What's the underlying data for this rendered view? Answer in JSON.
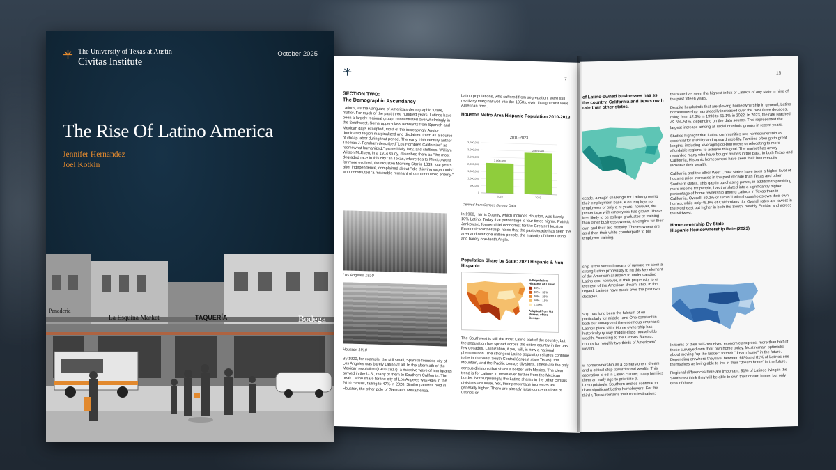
{
  "cover": {
    "university": "The University of Texas at Austin",
    "institute": "Civitas Institute",
    "date": "October 2025",
    "title": "The Rise Of Latino America",
    "authors": [
      "Jennifer Hernandez",
      "Joel Kotkin"
    ],
    "signs": [
      "La Esquina Market",
      "TAQUERÍA",
      "Bodega",
      "Panadería"
    ]
  },
  "page_left": {
    "page_number": "7",
    "section_title": "SECTION TWO:",
    "section_subtitle": "The Demographic Ascendancy",
    "col1_intro": "Latinos, as the vanguard of America's demographic future, matter. For much of the past three hundred years, Latinos have been a largely regional group, concentrated overwhelmingly in the Southwest. Some upper-class remnants from Spanish and Mexican days excepted, most of the increasingly Anglo-dominated region marginalized and disdained them as a source of cheap labor during that period. The early 19th century author Thomas J. Farnham described \"Los Hombres Californios\" as \"somewhat humanized,\" proverbially lazy, and shiftless. William Wilson McEuen, in a 1914 study, described them as \"the most degraded race in this city.\" In Texas, where ties to Mexico were far more evolved, the Houston Morning Star in 1839, four years after independence, complained about \"idle thieving vagabonds\" who constituted \"a miserable remnant of our conquered enemy.\"",
    "caption_la": "Los Angeles 1910",
    "caption_houston": "Houston 1910",
    "col1_bottom": "By 1900, for example, the still small, Spanish-founded city of Los Angeles was barely Latino at all. In the aftermath of the Mexican revolution (1910-1917), a massive wave of immigrants arrived in the U.S., many of them to Southern California. The peak Latino share for the city of Los Angeles was 48% in the 2010 census, falling to 47% in 2020. Similar patterns hold in Houston, the other pole of Garreau's Mexamerica.",
    "col2_top": "Latino populations, who suffered from segregation, were still relatively marginal well into the 1950s, even though most were American born.",
    "chart_heading": "Houston Metro Area Hispanic Population 2010-2013",
    "chart_source": "Derived from Census Bureau Data",
    "col2_mid": "In 1960, Harris County, which includes Houston, was barely 10% Latino. Today that percentage is four times higher. Patrick Jankowski, former chief economist for the Greater Houston Economic Partnership, notes that the past decade has seen the area add over one million people, the majority of them Latino and barely one-tenth Anglo.",
    "map_heading": "Population Share by State: 2020 Hispanic & Non-Hispanic",
    "map_legend_title": "% Population Hispanic or Latino",
    "map_legend_items": [
      "40% +",
      "30% - 39%",
      "20% - 29%",
      "10% - 19%",
      "< 10%"
    ],
    "map_legend_colors": [
      "#a8320e",
      "#d45a17",
      "#eb8d33",
      "#f5bf6c",
      "#fbe8b6"
    ],
    "map_note": "Adapted from US Bureau of the Census",
    "col2_bottom": "The Southwest is still the most Latino part of the country, but the population has spread across the entire country in the past few decades. Latinization, if you will, is now a national phenomenon. The strongest Latino population shares continue to be in the West South Central (largest state Texas), the Mountain, and the Pacific census divisions. These are the only census divisions that share a border with Mexico. The clear trend is for Latinos to move ever further from the Mexican border. Not surprisingly, the Latino shares in the other census divisions are lower. Yet, their percentage increases are generally higher. There are already large concentrations of Latinos on"
  },
  "page_right": {
    "page_number": "15",
    "col1_heading": "of Latino-owned businesses has ss the country. California and Texas owth rate than other states.",
    "col1_text": "ecade, a major challenge for Latino growing their employment base. A on employs no employees or only a nt years, however, the percentage with employees has grown. These less likely to be college graduates or training than other business owners, an engine for their own and their ard mobility. These owners are ated than their white counterparts to ble employee training.",
    "col1_text2": "ship is the second means of upward ve seen a strong Latino propensity to ng this key element of the American al aspect to understanding Latino ess, however, is their propensity to er element of the American dream: ship. In this regard, Latinos have made over the past two decades.",
    "col1_text3": "ship has long been the fulcrum of on particularly for middle- and One constant in both our survey and the enormous emphasis Latinos place ship. Home ownership has historically ry way middle-class households wealth. According to the Census Bureau, counts for roughly two-thirds of Americans' wealth.",
    "col1_text4": "w homeownership as a cornerstone n dream and a critical step toward tional wealth. This aspiration is ed in Latino culture; many families them an early age to prioritize p. Unsurprisingly, Southern and es continue to draw significant Latino homebuyers. For the third r, Texas remains their top destination;",
    "col2_top": "the state has seen the highest influx of Latinos of any state in nine of the past fifteen years.",
    "col2_p2": "Despite headwinds that are slowing homeownership in general, Latino homeownership has steadily increased over the past three decades, rising from 42.3% in 1990 to 51.1% in 2022. In 2023, the rate reached 49.5%–51%, depending on the data source. This represented the largest increase among all racial or ethnic groups in recent years.",
    "col2_p3": "Studies highlight that Latino communities see homeownership as essential for stability and upward mobility. Families often go to great lengths, including leveraging co-borrowers or relocating to more affordable regions, to achieve this goal. The market has amply rewarded many who have bought homes in the past. In both Texas and California, Hispanic homeowners have seen their home equity increase their wealth.",
    "col2_p4": "California and the other West Coast states have seen a higher level of housing price increases in the past decade than Texas and other Southern states. This gap in purchasing power, in addition to providing more income for people, has translated into a significantly higher percentage of home ownership among Latinos in Texas than in California. Overall, 59.2% of Texas' Latino households own their own homes, while only 45.9% of Californians do. Overall rates are lowest in the Northeast but higher in both the South, notably Florida, and across the Midwest.",
    "map_heading": "Homeownership By State",
    "map_subheading": "Hispanic Homeownership Rate (2023)",
    "col2_p5": "In terms of their self-perceived economic progress, more than half of those surveyed own their own home today. Most remain optimistic about moving \"up the ladder\" to their \"dream home\" in the future. Depending on where they live, between 68% and 81% of Latinos see themselves as being able to live in their \"dream home\" in the future.",
    "col2_p6": "Regional differences here are important: 81% of Latinos living in the Southeast think they will be able to own their dream home, but only 68% of those"
  },
  "chart_data": {
    "type": "bar",
    "title": "2010-2023",
    "categories": [
      "2010",
      "2023"
    ],
    "values": [
      2099000,
      2879000
    ],
    "value_labels": [
      "2,099,000",
      "2,879,000"
    ],
    "ylim": [
      0,
      3500000
    ],
    "yticks": [
      0,
      500000,
      1000000,
      1500000,
      2000000,
      2500000,
      3000000,
      3500000
    ],
    "ytick_labels": [
      "0",
      "500,000",
      "1,000,000",
      "1,500,000",
      "2,000,000",
      "2,500,000",
      "3,000,000",
      "3,500,000"
    ],
    "bar_color": "#8fcd3c",
    "grid": true
  }
}
